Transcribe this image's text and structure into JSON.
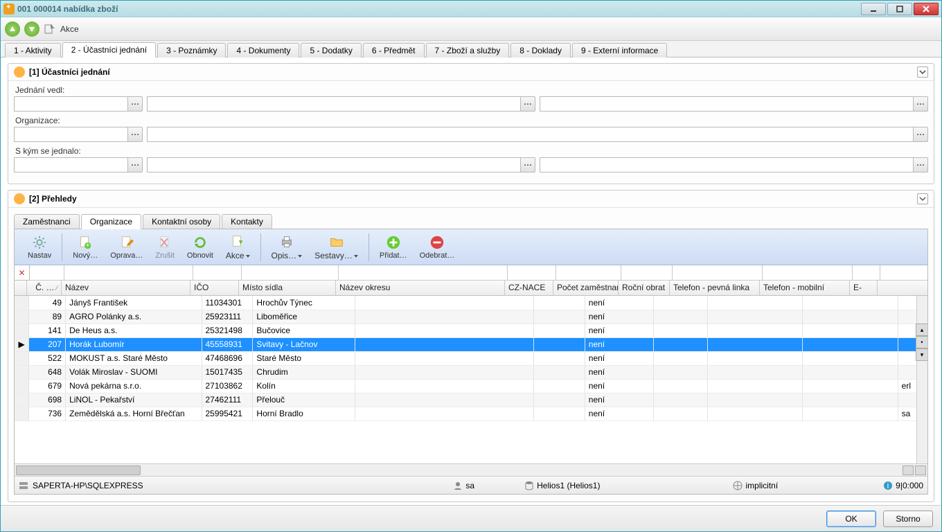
{
  "window": {
    "title": "001 000014  nabídka zboží"
  },
  "toolbar": {
    "akce": "Akce"
  },
  "mainTabs": [
    {
      "label": "1 - Aktivity"
    },
    {
      "label": "2 - Účastníci jednání",
      "active": true
    },
    {
      "label": "3 - Poznámky"
    },
    {
      "label": "4 - Dokumenty"
    },
    {
      "label": "5 - Dodatky"
    },
    {
      "label": "6 - Předmět"
    },
    {
      "label": "7 - Zboží a služby"
    },
    {
      "label": "8 - Doklady"
    },
    {
      "label": "9 - Externí informace"
    }
  ],
  "panel1": {
    "title": "[1] Účastníci jednání",
    "labels": {
      "jednaniVedl": "Jednání vedl:",
      "organizace": "Organizace:",
      "sKymSeJednalo": "S kým se jednalo:"
    }
  },
  "panel2": {
    "title": "[2] Přehledy",
    "subTabs": [
      {
        "label": "Zaměstnanci"
      },
      {
        "label": "Organizace",
        "active": true
      },
      {
        "label": "Kontaktní osoby"
      },
      {
        "label": "Kontakty"
      }
    ],
    "toolbar": {
      "nastav": "Nastav",
      "novy": "Nový…",
      "oprava": "Oprava…",
      "zrusit": "Zrušit",
      "obnovit": "Obnovit",
      "akce": "Akce",
      "opis": "Opis…",
      "sestavy": "Sestavy…",
      "pridat": "Přidat…",
      "odebrat": "Odebrat…"
    },
    "columns": {
      "c0": "Č. …",
      "c1": "Název",
      "c2": "IČO",
      "c3": "Místo sídla",
      "c4": "Název okresu",
      "c5": "CZ-NACE",
      "c6": "Počet zaměstnanců",
      "c7": "Roční obrat",
      "c8": "Telefon - pevná linka",
      "c9": "Telefon - mobilní",
      "c10": "E-"
    },
    "rows": [
      {
        "c0": "49",
        "c1": "Jányš František",
        "c2": "11034301",
        "c3": "Hrochův Týnec",
        "c4": "",
        "c5": "",
        "c6": "není",
        "c7": "",
        "c8": "",
        "c9": "",
        "c10": ""
      },
      {
        "c0": "89",
        "c1": "AGRO Polánky a.s.",
        "c2": "25923111",
        "c3": "Liboměřice",
        "c4": "",
        "c5": "",
        "c6": "není",
        "c7": "",
        "c8": "",
        "c9": "",
        "c10": ""
      },
      {
        "c0": "141",
        "c1": "De Heus a.s.",
        "c2": "25321498",
        "c3": "Bučovice",
        "c4": "",
        "c5": "",
        "c6": "není",
        "c7": "",
        "c8": "",
        "c9": "",
        "c10": ""
      },
      {
        "c0": "207",
        "c1": "Horák Lubomír",
        "c2": "45558931",
        "c3": "Svitavy - Lačnov",
        "c4": "",
        "c5": "",
        "c6": "není",
        "c7": "",
        "c8": "",
        "c9": "",
        "c10": "",
        "selected": true
      },
      {
        "c0": "522",
        "c1": "MOKUST a.s. Staré Město",
        "c2": "47468696",
        "c3": "Staré Město",
        "c4": "",
        "c5": "",
        "c6": "není",
        "c7": "",
        "c8": "",
        "c9": "",
        "c10": ""
      },
      {
        "c0": "648",
        "c1": "Volák Miroslav - SUOMI",
        "c2": "15017435",
        "c3": "Chrudim",
        "c4": "",
        "c5": "",
        "c6": "není",
        "c7": "",
        "c8": "",
        "c9": "",
        "c10": ""
      },
      {
        "c0": "679",
        "c1": "Nová pekárna s.r.o.",
        "c2": "27103862",
        "c3": "Kolín",
        "c4": "",
        "c5": "",
        "c6": "není",
        "c7": "",
        "c8": "",
        "c9": "",
        "c10": "erl"
      },
      {
        "c0": "698",
        "c1": "LiNOL - Pekařství",
        "c2": "27462111",
        "c3": "Přelouč",
        "c4": "",
        "c5": "",
        "c6": "není",
        "c7": "",
        "c8": "",
        "c9": "",
        "c10": ""
      },
      {
        "c0": "736",
        "c1": "Zemědělská a.s. Horní Břečťan",
        "c2": "25995421",
        "c3": "Horní Bradlo",
        "c4": "",
        "c5": "",
        "c6": "není",
        "c7": "",
        "c8": "",
        "c9": "",
        "c10": "sa"
      }
    ]
  },
  "status": {
    "server": "SAPERTA-HP\\SQLEXPRESS",
    "user": "sa",
    "db": "Helios1 (Helios1)",
    "profile": "implicitní",
    "rowcount": "9|0:000"
  },
  "buttons": {
    "ok": "OK",
    "storno": "Storno"
  }
}
